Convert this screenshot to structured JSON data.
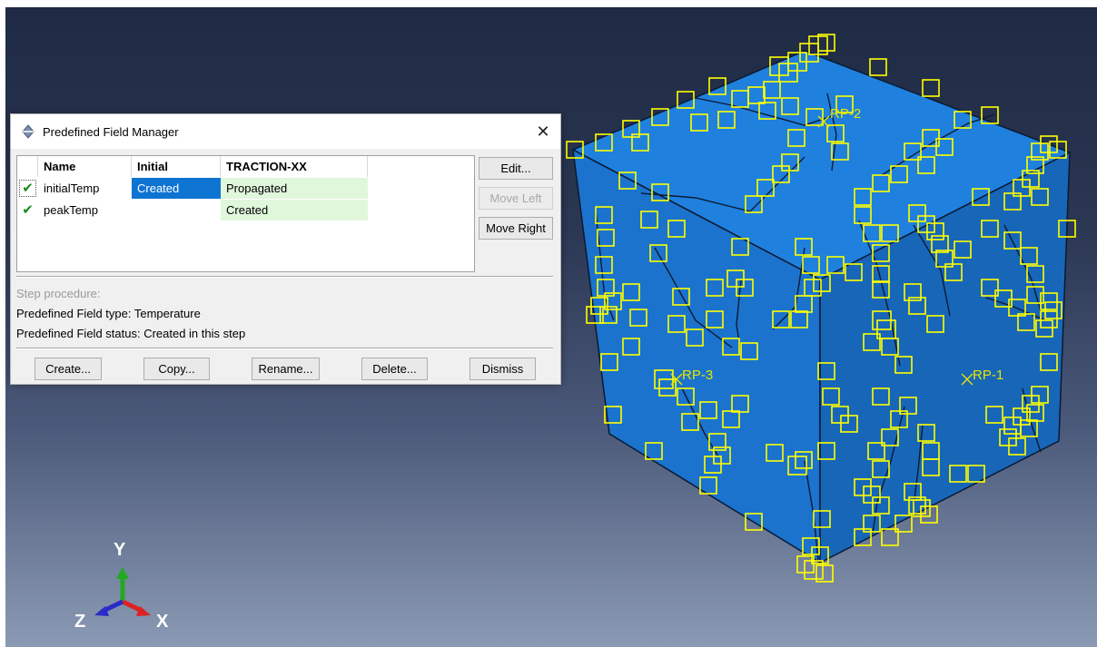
{
  "dialog": {
    "title": "Predefined Field Manager",
    "close_label": "✕",
    "columns": [
      "Name",
      "Initial",
      "TRACTION-XX"
    ],
    "rows": [
      {
        "check": "✔",
        "name": "initialTemp",
        "initial": "Created",
        "traction": "Propagated"
      },
      {
        "check": "✔",
        "name": "peakTemp",
        "initial": "",
        "traction": "Created"
      }
    ],
    "side_buttons": {
      "edit": "Edit...",
      "move_left": "Move Left",
      "move_right": "Move Right"
    },
    "step_procedure_label": "Step procedure:",
    "field_type": "Predefined Field type:   Temperature",
    "field_status": "Predefined Field status: Created in this step",
    "buttons": {
      "create": "Create...",
      "copy": "Copy...",
      "rename": "Rename...",
      "delete": "Delete...",
      "dismiss": "Dismiss"
    }
  },
  "viewport": {
    "reference_points": [
      "RP-1",
      "RP-2",
      "RP-3"
    ],
    "axes": {
      "y": "Y",
      "x": "X",
      "z": "Z"
    },
    "colors": {
      "cube_top": "#1f7fdd",
      "cube_left": "#1a72cc",
      "cube_right": "#1864b6",
      "markers": "#ffff00",
      "axis_y": "#22aa22",
      "axis_x": "#dd2222",
      "axis_z": "#2222cc"
    }
  }
}
